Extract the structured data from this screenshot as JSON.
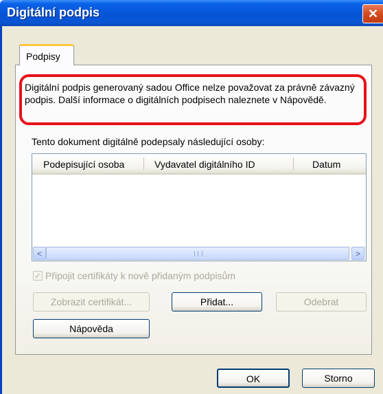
{
  "window": {
    "title": "Digitální podpis",
    "close_glyph": "✕"
  },
  "tabs": [
    {
      "label": "Podpisy"
    }
  ],
  "warning": {
    "text": "Digitální podpis generovaný sadou Office nelze považovat za právně závazný podpis. Další informace o digitálních podpisech naleznete v Nápovědě."
  },
  "signers": {
    "label": "Tento dokument digitálně podepsaly následující osoby:",
    "columns": [
      "Podepisující osoba",
      "Vydavatel digitálního ID",
      "Datum"
    ],
    "rows": []
  },
  "scroll": {
    "left_glyph": "<",
    "right_glyph": ">"
  },
  "attach_certs": {
    "label": "Připojit certifikáty k nově přidaným podpisům",
    "checked": true,
    "check_glyph": "✓",
    "enabled": false
  },
  "buttons": {
    "view_cert": "Zobrazit certifikát...",
    "add": "Přidat...",
    "remove": "Odebrat",
    "help": "Nápověda",
    "ok": "OK",
    "cancel": "Storno"
  },
  "colors": {
    "titlebar": "#0654d6",
    "highlight": "#e6111a",
    "tab_accent": "#ffc83c",
    "dialog_bg": "#ece9d8"
  }
}
